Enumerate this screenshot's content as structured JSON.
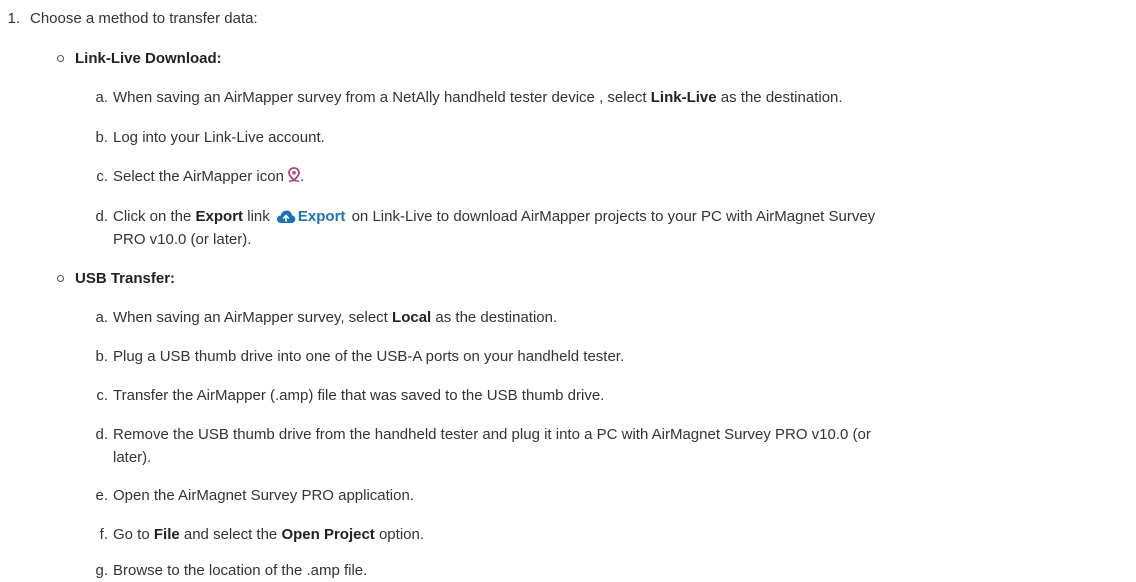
{
  "step": {
    "number": "1.",
    "text": "Choose a method to transfer data:"
  },
  "methods": [
    {
      "title": "Link-Live Download:",
      "items": [
        {
          "letter": "a.",
          "pre": "When saving an AirMapper survey from a NetAlly handheld tester device , select ",
          "bold": "Link-Live",
          "post": " as the destination."
        },
        {
          "letter": "b.",
          "text": "Log into your Link-Live account."
        },
        {
          "letter": "c.",
          "pre": "Select the AirMapper icon ",
          "icon": "airmapper-pin-icon",
          "post": "."
        },
        {
          "letter": "d.",
          "pre": "Click on the ",
          "bold": "Export",
          "mid": " link ",
          "button_icon": "cloud-upload-icon",
          "button_label": "Export",
          "post": " on Link-Live to download AirMapper projects to your PC with AirMagnet Survey",
          "cont": "PRO v10.0 (or later)."
        }
      ]
    },
    {
      "title": "USB Transfer:",
      "items": [
        {
          "letter": "a.",
          "pre": "When saving an AirMapper survey, select ",
          "bold": "Local",
          "post": " as the destination."
        },
        {
          "letter": "b.",
          "text": "Plug a USB thumb drive into one of the USB-A ports on your handheld tester."
        },
        {
          "letter": "c.",
          "text": "Transfer the AirMapper (.amp) file that was saved to the USB thumb drive."
        },
        {
          "letter": "d.",
          "text": "Remove the USB thumb drive from the handheld tester and plug it into a PC with AirMagnet Survey PRO v10.0 (or",
          "cont": "later)."
        },
        {
          "letter": "e.",
          "text": "Open the AirMagnet Survey PRO application."
        },
        {
          "letter": "f.",
          "pre": "Go to ",
          "bold": "File",
          "mid": " and select the ",
          "bold2": "Open Project",
          "post": " option."
        },
        {
          "letter": "g.",
          "text": "Browse to the location of the .amp file."
        }
      ]
    }
  ],
  "colors": {
    "text": "#333333",
    "export_link": "#1a73b8",
    "pin_icon": "#b0467a"
  }
}
